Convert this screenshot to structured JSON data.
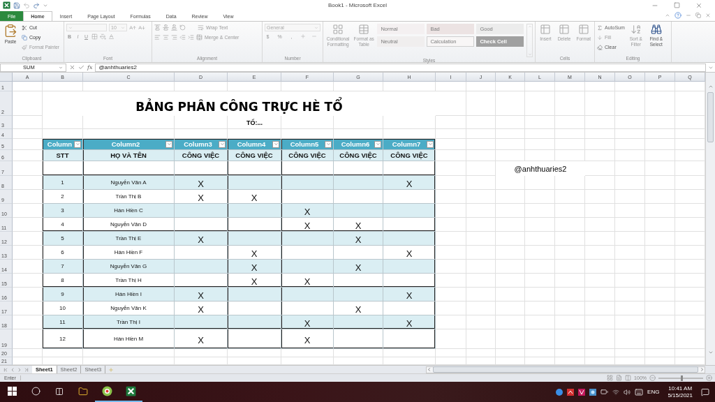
{
  "window": {
    "title": "Book1 - Microsoft Excel"
  },
  "ribbon_tabs": [
    {
      "label": "File",
      "kind": "file",
      "selected": false
    },
    {
      "label": "Home",
      "kind": "tab",
      "selected": true
    },
    {
      "label": "Insert",
      "kind": "tab",
      "selected": false
    },
    {
      "label": "Page Layout",
      "kind": "tab",
      "selected": false
    },
    {
      "label": "Formulas",
      "kind": "tab",
      "selected": false
    },
    {
      "label": "Data",
      "kind": "tab",
      "selected": false
    },
    {
      "label": "Review",
      "kind": "tab",
      "selected": false
    },
    {
      "label": "View",
      "kind": "tab",
      "selected": false
    }
  ],
  "ribbon": {
    "clipboard": {
      "label": "Clipboard",
      "paste": "Paste",
      "cut": "Cut",
      "copy": "Copy",
      "format_painter": "Format Painter"
    },
    "font": {
      "label": "Font",
      "size": "10",
      "bold": "B",
      "italic": "I",
      "underline": "U"
    },
    "alignment": {
      "label": "Alignment",
      "wrap_text": "Wrap Text",
      "merge_center": "Merge & Center"
    },
    "number": {
      "label": "Number",
      "format": "General",
      "currency": "$",
      "percent": "%",
      "comma": ","
    },
    "styles": {
      "label": "Styles",
      "conditional_formatting": "Conditional Formatting",
      "format_as_table": "Format as Table",
      "cell_styles": [
        {
          "label": "Normal",
          "kind": "normal"
        },
        {
          "label": "Bad",
          "kind": "bad"
        },
        {
          "label": "Good",
          "kind": "good"
        },
        {
          "label": "Neutral",
          "kind": "neutral"
        },
        {
          "label": "Calculation",
          "kind": "calculation"
        },
        {
          "label": "Check Cell",
          "kind": "check"
        }
      ]
    },
    "cells": {
      "label": "Cells",
      "insert": "Insert",
      "delete": "Delete",
      "format": "Format"
    },
    "editing": {
      "label": "Editing",
      "autosum": "AutoSum",
      "fill": "Fill",
      "clear": "Clear",
      "sort_filter": "Sort & Filter",
      "find_select": "Find & Select"
    }
  },
  "formula_bar": {
    "name_box": "SUM",
    "function_label": "fx",
    "formula": "@anhthuaries2"
  },
  "sheet": {
    "columns": [
      "A",
      "B",
      "C",
      "D",
      "E",
      "F",
      "G",
      "H",
      "I",
      "J",
      "K",
      "L",
      "M",
      "N",
      "O",
      "P",
      "Q"
    ],
    "rows": [
      "1",
      "2",
      "3",
      "4",
      "5",
      "6",
      "7",
      "8",
      "9",
      "10",
      "11",
      "12",
      "13",
      "14",
      "15",
      "16",
      "17",
      "18",
      "19",
      "20",
      "21"
    ],
    "title": "BẢNG PHÂN CÔNG TRỰC HÈ TỔ",
    "subtitle": "TỐ:...",
    "note": "@anhthuaries2",
    "table": {
      "headers": [
        "Column",
        "Column2",
        "Column3",
        "Column4",
        "Column5",
        "Column6",
        "Column7"
      ],
      "subheaders": [
        "STT",
        "HỌ VÀ TÊN",
        "CÔNG VIỆC",
        "CÔNG VIỆC",
        "CÔNG VIỆC",
        "CÔNG VIỆC",
        "CÔNG VIỆC"
      ],
      "rows": [
        {
          "stt": "1",
          "name": "Nguyễn Văn A",
          "cells": [
            "X",
            null,
            null,
            null,
            "X"
          ]
        },
        {
          "stt": "2",
          "name": "Trần Thị B",
          "cells": [
            "X",
            "X",
            null,
            null,
            null
          ]
        },
        {
          "stt": "3",
          "name": "Hán Hiền C",
          "cells": [
            null,
            null,
            "X",
            null,
            null
          ]
        },
        {
          "stt": "4",
          "name": "Nguyễn Văn D",
          "cells": [
            null,
            null,
            "X",
            "X",
            null
          ]
        },
        {
          "stt": "5",
          "name": "Trần Thị E",
          "cells": [
            "X",
            null,
            null,
            "X",
            null
          ]
        },
        {
          "stt": "6",
          "name": "Hán Hiền F",
          "cells": [
            null,
            "X",
            null,
            null,
            "X"
          ]
        },
        {
          "stt": "7",
          "name": "Nguyễn Văn G",
          "cells": [
            null,
            "X",
            null,
            "X",
            null
          ]
        },
        {
          "stt": "8",
          "name": "Trần Thị H",
          "cells": [
            null,
            "X",
            "X",
            null,
            null
          ]
        },
        {
          "stt": "9",
          "name": "Hán Hiền I",
          "cells": [
            "X",
            null,
            null,
            null,
            "X"
          ]
        },
        {
          "stt": "10",
          "name": "Nguyễn Văn K",
          "cells": [
            "X",
            null,
            null,
            "X",
            null
          ]
        },
        {
          "stt": "11",
          "name": "Trần Thị I",
          "cells": [
            null,
            null,
            "X",
            null,
            "X"
          ]
        },
        {
          "stt": "12",
          "name": "Hán Hiền M",
          "cells": [
            "X",
            null,
            "X",
            null,
            null
          ]
        }
      ]
    }
  },
  "sheet_tabs": [
    {
      "label": "Sheet1",
      "selected": true
    },
    {
      "label": "Sheet2",
      "selected": false
    },
    {
      "label": "Sheet3",
      "selected": false
    }
  ],
  "status_bar": {
    "mode": "Enter",
    "zoom": "100%",
    "zoom_level": {
      "level": 0.5
    }
  },
  "taskbar": {
    "language": "ENG",
    "time": "10:41 AM",
    "date": "5/15/2021"
  }
}
